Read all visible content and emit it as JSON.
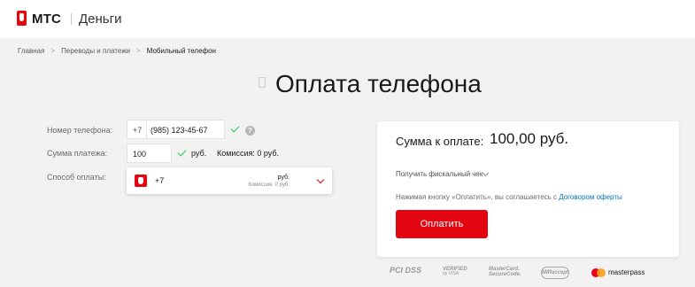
{
  "header": {
    "brand": "МТС",
    "product": "Деньги"
  },
  "breadcrumb": {
    "items": [
      "Главная",
      "Переводы и платежи"
    ],
    "separator": ">",
    "current": "Мобильный телефон"
  },
  "page": {
    "title": "Оплата телефона"
  },
  "form": {
    "phone_label": "Номер телефона:",
    "phone_prefix": "+7",
    "phone_value": "(985) 123-45-67",
    "help_glyph": "?",
    "amount_label": "Сумма платежа:",
    "amount_value": "100",
    "currency": "руб.",
    "commission": "Комиссия: 0 руб.",
    "method_label": "Способ оплаты:",
    "method": {
      "number": "+7",
      "balance": "руб.",
      "commission": "Комиссия: 0 руб."
    }
  },
  "summary": {
    "label": "Сумма к оплате:",
    "value": "100,00 руб.",
    "fiscal": "Получить фискальный чек",
    "agreement_text": "Нажимая кнопку «Оплатить», вы соглашаетесь с ",
    "agreement_link": "Договором оферты",
    "pay_button": "Оплатить"
  },
  "security": {
    "pci": "PCI DSS",
    "verified": "VERIFIED",
    "verified_sub": "by VISA",
    "mc_line1": "MasterCard.",
    "mc_line2": "SecureCode.",
    "mir": "MIRaccept",
    "masterpass": "masterpass"
  },
  "colors": {
    "brand_red": "#e30611",
    "link_blue": "#0077bd",
    "check_green": "#26cd58"
  },
  "icons": [
    "mts-logo-icon",
    "phone-icon",
    "checkmark-icon",
    "help-icon",
    "mts-card-icon",
    "chevron-down-icon",
    "mastercard-icon"
  ]
}
